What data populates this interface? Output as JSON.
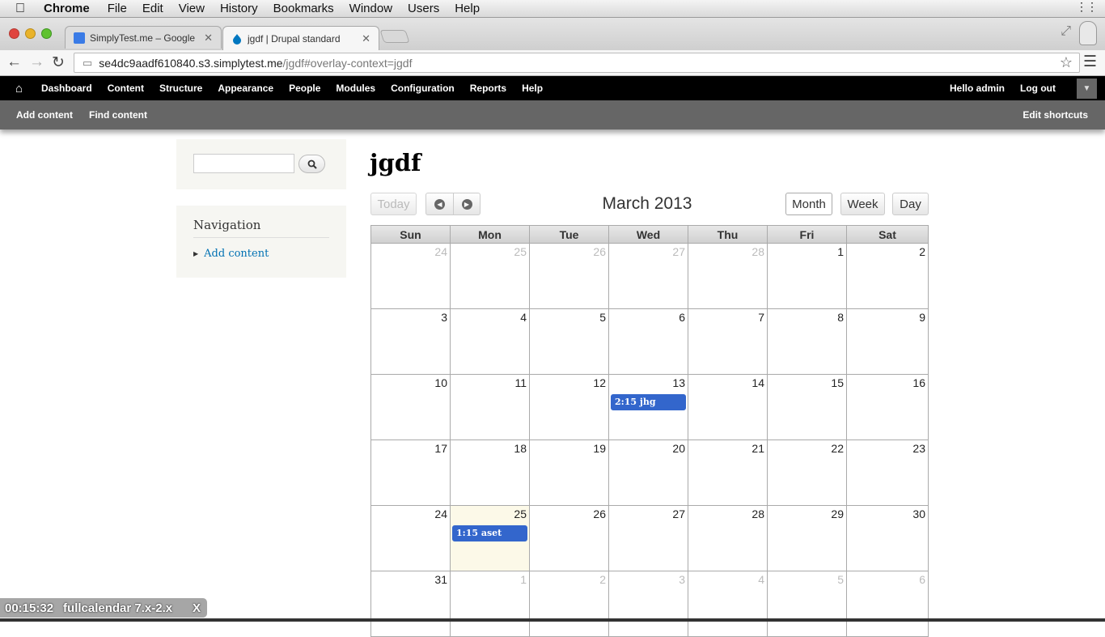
{
  "mac_menu": {
    "app": "Chrome",
    "items": [
      "File",
      "Edit",
      "View",
      "History",
      "Bookmarks",
      "Window",
      "Users",
      "Help"
    ]
  },
  "tabs": [
    {
      "title": "SimplyTest.me – Google D",
      "active": false
    },
    {
      "title": "jgdf | Drupal standard",
      "active": true
    }
  ],
  "url": {
    "host": "se4dc9aadf610840.s3.simplytest.me",
    "path": "/jgdf#overlay-context=jgdf"
  },
  "admin_menu": {
    "items": [
      "Dashboard",
      "Content",
      "Structure",
      "Appearance",
      "People",
      "Modules",
      "Configuration",
      "Reports",
      "Help"
    ],
    "hello": "Hello admin",
    "logout": "Log out"
  },
  "shortcuts": {
    "items": [
      "Add content",
      "Find content"
    ],
    "edit": "Edit shortcuts"
  },
  "sidebar": {
    "nav_title": "Navigation",
    "nav_link": "Add content"
  },
  "page_title": "jgdf",
  "calendar": {
    "title": "March 2013",
    "today_label": "Today",
    "views": [
      "Month",
      "Week",
      "Day"
    ],
    "active_view": "Month",
    "weekdays": [
      "Sun",
      "Mon",
      "Tue",
      "Wed",
      "Thu",
      "Fri",
      "Sat"
    ],
    "weeks": [
      [
        {
          "d": "24",
          "o": true
        },
        {
          "d": "25",
          "o": true
        },
        {
          "d": "26",
          "o": true
        },
        {
          "d": "27",
          "o": true
        },
        {
          "d": "28",
          "o": true
        },
        {
          "d": "1"
        },
        {
          "d": "2"
        }
      ],
      [
        {
          "d": "3"
        },
        {
          "d": "4"
        },
        {
          "d": "5"
        },
        {
          "d": "6"
        },
        {
          "d": "7"
        },
        {
          "d": "8"
        },
        {
          "d": "9"
        }
      ],
      [
        {
          "d": "10"
        },
        {
          "d": "11"
        },
        {
          "d": "12"
        },
        {
          "d": "13",
          "event": "2:15 jhg"
        },
        {
          "d": "14"
        },
        {
          "d": "15"
        },
        {
          "d": "16"
        }
      ],
      [
        {
          "d": "17"
        },
        {
          "d": "18"
        },
        {
          "d": "19"
        },
        {
          "d": "20"
        },
        {
          "d": "21"
        },
        {
          "d": "22"
        },
        {
          "d": "23"
        }
      ],
      [
        {
          "d": "24"
        },
        {
          "d": "25",
          "today": true,
          "event": "1:15 aset"
        },
        {
          "d": "26"
        },
        {
          "d": "27"
        },
        {
          "d": "28"
        },
        {
          "d": "29"
        },
        {
          "d": "30"
        }
      ],
      [
        {
          "d": "31"
        },
        {
          "d": "1",
          "o": true
        },
        {
          "d": "2",
          "o": true
        },
        {
          "d": "3",
          "o": true
        },
        {
          "d": "4",
          "o": true
        },
        {
          "d": "5",
          "o": true
        },
        {
          "d": "6",
          "o": true
        }
      ]
    ],
    "event_color": "#3366cc"
  },
  "timer": {
    "time": "00:15:32",
    "label": "fullcalendar 7.x-2.x",
    "close": "X"
  }
}
